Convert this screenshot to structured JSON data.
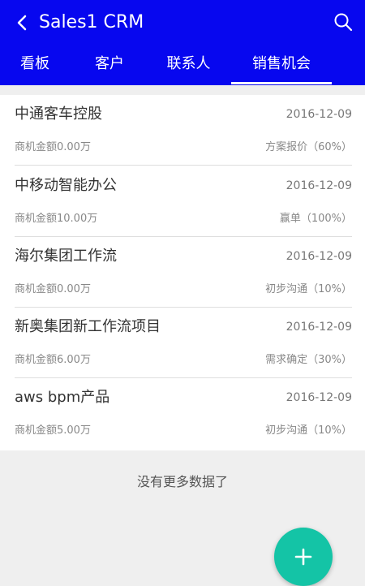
{
  "header": {
    "title": "Sales1 CRM",
    "tabs": [
      {
        "label": "看板"
      },
      {
        "label": "客户"
      },
      {
        "label": "联系人"
      },
      {
        "label": "销售机会"
      }
    ],
    "active_tab": "销售机会"
  },
  "opportunities": [
    {
      "name": "中通客车控股",
      "date": "2016-12-09",
      "amount": "商机金额0.00万",
      "stage": "方案报价（60%）"
    },
    {
      "name": "中移动智能办公",
      "date": "2016-12-09",
      "amount": "商机金额10.00万",
      "stage": "赢单（100%）"
    },
    {
      "name": "海尔集团工作流",
      "date": "2016-12-09",
      "amount": "商机金额0.00万",
      "stage": "初步沟通（10%）"
    },
    {
      "name": "新奥集团新工作流项目",
      "date": "2016-12-09",
      "amount": "商机金额6.00万",
      "stage": "需求确定（30%）"
    },
    {
      "name": "aws bpm产品",
      "date": "2016-12-09",
      "amount": "商机金额5.00万",
      "stage": "初步沟通（10%）"
    }
  ],
  "footer": {
    "no_more_text": "没有更多数据了"
  },
  "colors": {
    "header_bg": "#0707ef",
    "fab_bg": "#14c4a6"
  },
  "icons": {
    "back": "back-arrow-icon",
    "search": "search-icon",
    "fab": "plus-icon"
  }
}
